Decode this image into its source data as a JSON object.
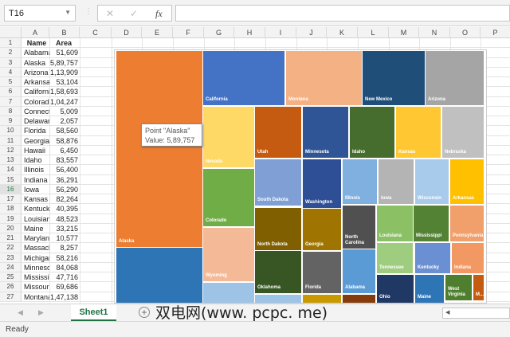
{
  "name_box": "T16",
  "formula_bar": {
    "cancel": "✕",
    "enter": "✓",
    "fx": "fx",
    "value": ""
  },
  "columns": [
    "A",
    "B",
    "C",
    "D",
    "E",
    "F",
    "G",
    "H",
    "I",
    "J",
    "K",
    "L",
    "M",
    "N",
    "O",
    "P"
  ],
  "headers": {
    "name": "Name",
    "area": "Area"
  },
  "rows": [
    [
      "Alabama",
      "51,609"
    ],
    [
      "Alaska",
      "5,89,757"
    ],
    [
      "Arizona",
      "1,13,909"
    ],
    [
      "Arkansas",
      "53,104"
    ],
    [
      "California",
      "1,58,693"
    ],
    [
      "Colorado",
      "1,04,247"
    ],
    [
      "Connecticut",
      "5,009"
    ],
    [
      "Delaware",
      "2,057"
    ],
    [
      "Florida",
      "58,560"
    ],
    [
      "Georgia",
      "58,876"
    ],
    [
      "Hawaii",
      "6,450"
    ],
    [
      "Idaho",
      "83,557"
    ],
    [
      "Illinois",
      "56,400"
    ],
    [
      "Indiana",
      "36,291"
    ],
    [
      "Iowa",
      "56,290"
    ],
    [
      "Kansas",
      "82,264"
    ],
    [
      "Kentucky",
      "40,395"
    ],
    [
      "Louisiana",
      "48,523"
    ],
    [
      "Maine",
      "33,215"
    ],
    [
      "Maryland",
      "10,577"
    ],
    [
      "Massachusetts",
      "8,257"
    ],
    [
      "Michigan",
      "58,216"
    ],
    [
      "Minnesota",
      "84,068"
    ],
    [
      "Mississippi",
      "47,716"
    ],
    [
      "Missouri",
      "69,686"
    ],
    [
      "Montana",
      "1,47,138"
    ]
  ],
  "selected_row": 16,
  "chart_data": {
    "type": "treemap",
    "tiles": [
      {
        "name": "Alaska",
        "color": "#ed7d31"
      },
      {
        "name": "",
        "color": "#2e75b6"
      },
      {
        "name": "California",
        "color": "#4472c4"
      },
      {
        "name": "Montana",
        "color": "#f4b183"
      },
      {
        "name": "New Mexico",
        "color": "#1f4e79"
      },
      {
        "name": "Arizona",
        "color": "#a5a5a5"
      },
      {
        "name": "Nevada",
        "color": "#ffd966"
      },
      {
        "name": "Colorado",
        "color": "#70ad47"
      },
      {
        "name": "Wyoming",
        "color": "#f4b996"
      },
      {
        "name": "",
        "color": "#9dc3e6"
      },
      {
        "name": "Utah",
        "color": "#c55a11"
      },
      {
        "name": "Minnesota",
        "color": "#2f5597"
      },
      {
        "name": "Idaho",
        "color": "#476d2e"
      },
      {
        "name": "Kansas",
        "color": "#ffc832"
      },
      {
        "name": "Nebraska",
        "color": "#c0c0c0"
      },
      {
        "name": "South Dakota",
        "color": "#7f9fd5"
      },
      {
        "name": "Washington",
        "color": "#2e4e96"
      },
      {
        "name": "Illinois",
        "color": "#7fb0e0"
      },
      {
        "name": "Iowa",
        "color": "#b4b4b4"
      },
      {
        "name": "Wisconsin",
        "color": "#a9cbeb"
      },
      {
        "name": "Arkansas",
        "color": "#ffc000"
      },
      {
        "name": "North Dakota",
        "color": "#7f5f00"
      },
      {
        "name": "Georgia",
        "color": "#a07400"
      },
      {
        "name": "Oklahoma",
        "color": "#375623"
      },
      {
        "name": "Florida",
        "color": "#636363"
      },
      {
        "name": "",
        "color": "#9dc3e6"
      },
      {
        "name": "",
        "color": "#c99a00"
      },
      {
        "name": "North Carolina",
        "color": "#505050"
      },
      {
        "name": "Alabama",
        "color": "#5b9bd5"
      },
      {
        "name": "",
        "color": "#843c0c"
      },
      {
        "name": "Louisiana",
        "color": "#8bc064"
      },
      {
        "name": "Mississippi",
        "color": "#548235"
      },
      {
        "name": "Pennsylvania",
        "color": "#f19f6b"
      },
      {
        "name": "Tennessee",
        "color": "#9fcd7f"
      },
      {
        "name": "Kentucky",
        "color": "#6a8fd3"
      },
      {
        "name": "Indiana",
        "color": "#f29863"
      },
      {
        "name": "Ohio",
        "color": "#203864"
      },
      {
        "name": "Maine",
        "color": "#2e75b6"
      },
      {
        "name": "West Virginia",
        "color": "#4f7f2e"
      },
      {
        "name": "M...",
        "color": "#c55a11"
      }
    ],
    "tooltip": {
      "point": "Point \"Alaska\"",
      "value": "Value: 5,89,757"
    }
  },
  "sheet_tab": "Sheet1",
  "add_sheet": "+",
  "watermark": "双电网(www. pcpc. me)",
  "status": "Ready"
}
